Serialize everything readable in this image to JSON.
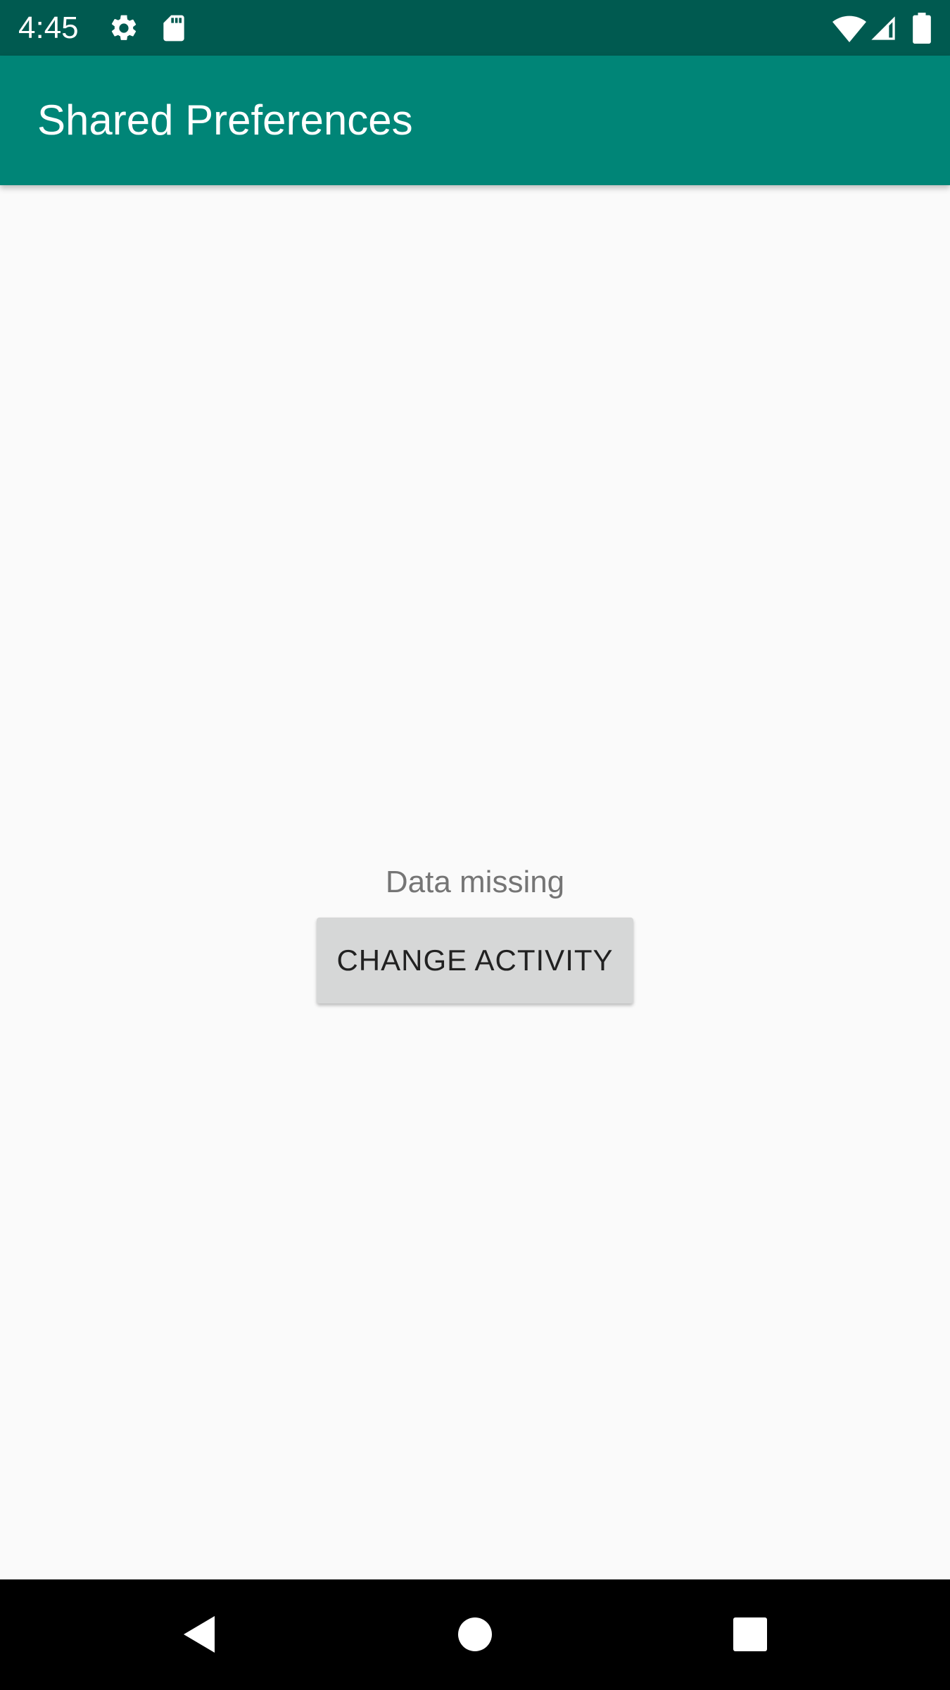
{
  "status_bar": {
    "time": "4:45",
    "icons": [
      "settings-icon",
      "sd-card-icon",
      "wifi-icon",
      "cellular-signal-icon",
      "battery-icon"
    ]
  },
  "app_bar": {
    "title": "Shared Preferences",
    "color": "#008577"
  },
  "main": {
    "message": "Data missing",
    "button_label": "CHANGE ACTIVITY"
  },
  "nav_bar": {
    "icons": [
      "back-icon",
      "home-icon",
      "recents-icon"
    ]
  },
  "colors": {
    "status_bar": "#005A50",
    "app_bar": "#008577",
    "background": "#FAFAFA",
    "button": "#D6D7D7"
  }
}
